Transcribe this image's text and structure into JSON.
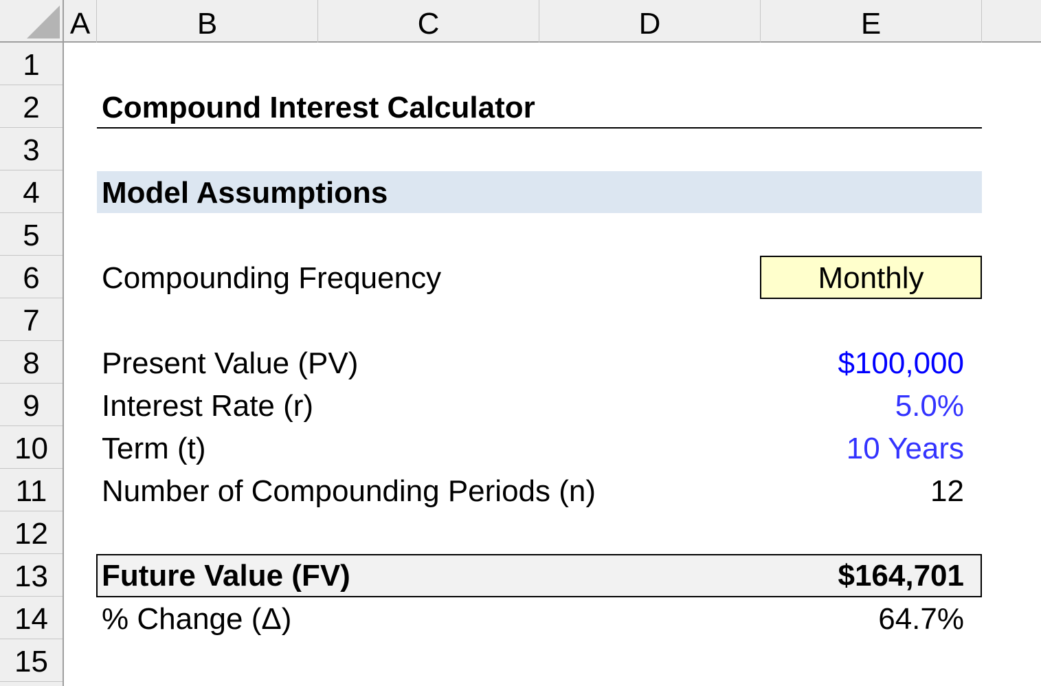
{
  "grid": {
    "columns": [
      "A",
      "B",
      "C",
      "D",
      "E"
    ],
    "rows": [
      "1",
      "2",
      "3",
      "4",
      "5",
      "6",
      "7",
      "8",
      "9",
      "10",
      "11",
      "12",
      "13",
      "14",
      "15"
    ]
  },
  "sheet": {
    "title": "Compound Interest Calculator",
    "section_header": "Model Assumptions",
    "compounding": {
      "label": "Compounding Frequency",
      "value": "Monthly"
    },
    "present_value": {
      "label": "Present Value (PV)",
      "value": "$100,000"
    },
    "interest_rate": {
      "label": "Interest Rate (r)",
      "value": "5.0%"
    },
    "term": {
      "label": "Term (t)",
      "value": "10 Years"
    },
    "periods": {
      "label": "Number of Compounding Periods (n)",
      "value": "12"
    },
    "future_value": {
      "label": "Future Value (FV)",
      "value": "$164,701"
    },
    "pct_change": {
      "label": "% Change (Δ)",
      "value": "64.7%"
    }
  },
  "colors": {
    "input_blue_strong": "#0000ff",
    "input_blue": "#3333ff",
    "section_fill": "#dce6f1",
    "input_fill": "#ffffcc",
    "output_fill": "#f2f2f2"
  }
}
